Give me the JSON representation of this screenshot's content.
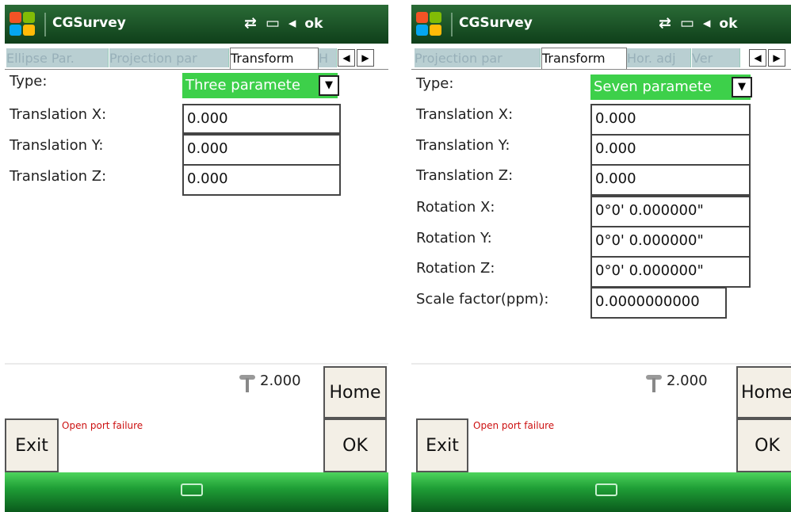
{
  "screens": [
    {
      "title": "CGSurvey",
      "sys_ok": "ok",
      "tabs": [
        "Ellipse Par.",
        "Projection par",
        "Transform",
        "H"
      ],
      "type_label": "Type:",
      "type_value": "Three paramete",
      "fields": [
        {
          "label": "Translation X:",
          "value": "0.000"
        },
        {
          "label": "Translation Y:",
          "value": "0.000"
        },
        {
          "label": "Translation Z:",
          "value": "0.000"
        }
      ],
      "antenna_height": "2.000",
      "home_label": "Home",
      "exit_label": "Exit",
      "ok_label": "OK",
      "status_text": "Open port failure"
    },
    {
      "title": "CGSurvey",
      "sys_ok": "ok",
      "tabs": [
        "Projection par",
        "Transform",
        "Hor. adj",
        "Ver"
      ],
      "type_label": "Type:",
      "type_value": "Seven paramete",
      "fields": [
        {
          "label": "Translation X:",
          "value": "0.000"
        },
        {
          "label": "Translation Y:",
          "value": "0.000"
        },
        {
          "label": "Translation Z:",
          "value": "0.000"
        },
        {
          "label": "Rotation X:",
          "value": "0°0' 0.000000\""
        },
        {
          "label": "Rotation Y:",
          "value": "0°0' 0.000000\""
        },
        {
          "label": "Rotation Z:",
          "value": "0°0' 0.000000\""
        },
        {
          "label": "Scale factor(ppm):",
          "value": "0.0000000000"
        }
      ],
      "antenna_height": "2.000",
      "home_label": "Home",
      "exit_label": "Exit",
      "ok_label": "OK",
      "status_text": "Open port failure"
    }
  ],
  "colors": {
    "titlebar": "#1c5427",
    "dropdown_selected": "#3dd04a",
    "status_error": "#cc1111",
    "taskbar": "#1f9e36"
  },
  "icons": [
    "windows-start-icon",
    "connectivity-icon",
    "battery-icon",
    "volume-icon",
    "antenna-icon",
    "keyboard-icon",
    "tab-left-arrow-icon",
    "tab-right-arrow-icon",
    "dropdown-arrow-icon"
  ]
}
